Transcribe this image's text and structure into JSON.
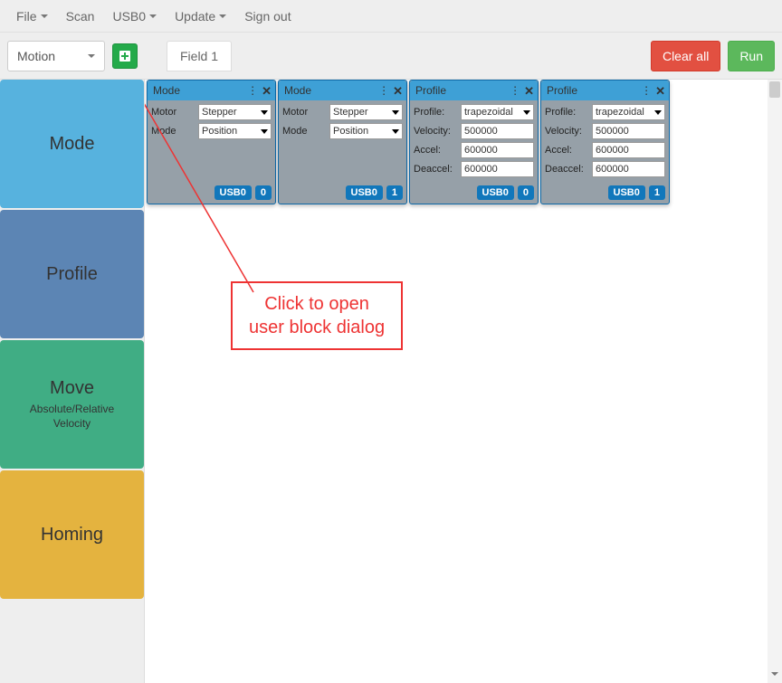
{
  "nav": {
    "file": "File",
    "scan": "Scan",
    "usb": "USB0",
    "update": "Update",
    "signout": "Sign out"
  },
  "toolbar": {
    "category_selected": "Motion",
    "tab1": "Field 1",
    "clear_all": "Clear all",
    "run": "Run"
  },
  "sidebar": {
    "items": [
      {
        "color": "#57b2de",
        "title": "Mode",
        "sub": ""
      },
      {
        "color": "#5c85b4",
        "title": "Profile",
        "sub": ""
      },
      {
        "color": "#40ad84",
        "title": "Move",
        "sub": "Absolute/Relative\nVelocity"
      },
      {
        "color": "#e4b33f",
        "title": "Homing",
        "sub": ""
      }
    ]
  },
  "blocks": [
    {
      "type": "Mode",
      "rows": [
        {
          "label": "Motor",
          "kind": "select",
          "value": "Stepper"
        },
        {
          "label": "Mode",
          "kind": "select",
          "value": "Position"
        }
      ],
      "footer": {
        "port": "USB0",
        "id": "0"
      }
    },
    {
      "type": "Mode",
      "rows": [
        {
          "label": "Motor",
          "kind": "select",
          "value": "Stepper"
        },
        {
          "label": "Mode",
          "kind": "select",
          "value": "Position"
        }
      ],
      "footer": {
        "port": "USB0",
        "id": "1"
      }
    },
    {
      "type": "Profile",
      "rows": [
        {
          "label": "Profile:",
          "kind": "select",
          "value": "trapezoidal"
        },
        {
          "label": "Velocity:",
          "kind": "text",
          "value": "500000"
        },
        {
          "label": "Accel:",
          "kind": "text",
          "value": "600000"
        },
        {
          "label": "Deaccel:",
          "kind": "text",
          "value": "600000"
        }
      ],
      "footer": {
        "port": "USB0",
        "id": "0"
      }
    },
    {
      "type": "Profile",
      "rows": [
        {
          "label": "Profile:",
          "kind": "select",
          "value": "trapezoidal"
        },
        {
          "label": "Velocity:",
          "kind": "text",
          "value": "500000"
        },
        {
          "label": "Accel:",
          "kind": "text",
          "value": "600000"
        },
        {
          "label": "Deaccel:",
          "kind": "text",
          "value": "600000"
        }
      ],
      "footer": {
        "port": "USB0",
        "id": "1"
      }
    }
  ],
  "annotation": {
    "line1": "Click to open",
    "line2": "user block dialog"
  }
}
